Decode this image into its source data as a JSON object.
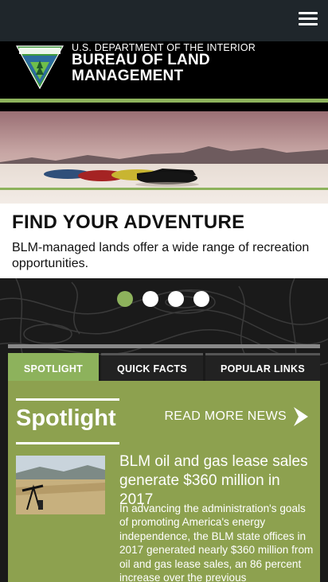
{
  "header": {
    "menu_icon": "hamburger-menu-icon",
    "department": "U.S. DEPARTMENT OF THE INTERIOR",
    "agency_line1": "BUREAU OF LAND",
    "agency_line2": "MANAGEMENT",
    "logo_icon": "blm-shield-logo"
  },
  "carousel": {
    "headline": "FIND YOUR ADVENTURE",
    "description": "BLM-managed lands offer a wide range of recreation opportunities.",
    "slide_count": 4,
    "active_slide": 1
  },
  "tabs": [
    {
      "label": "SPOTLIGHT",
      "active": true
    },
    {
      "label": "QUICK FACTS",
      "active": false
    },
    {
      "label": "POPULAR LINKS",
      "active": false
    }
  ],
  "spotlight": {
    "title": "Spotlight",
    "read_more": "READ MORE NEWS",
    "read_more_icon": "chevron-right-icon",
    "article": {
      "title": "BLM oil and gas lease sales generate $360 million in 2017",
      "body": "In advancing the administration's goals of promoting America's energy independence, the BLM state offices in 2017 generated nearly $360 million from oil and gas lease sales, an 86 percent increase over the previous"
    }
  },
  "colors": {
    "accent_green": "#8db25c",
    "panel_green": "#8da14f",
    "header_dark": "#1f262b"
  }
}
